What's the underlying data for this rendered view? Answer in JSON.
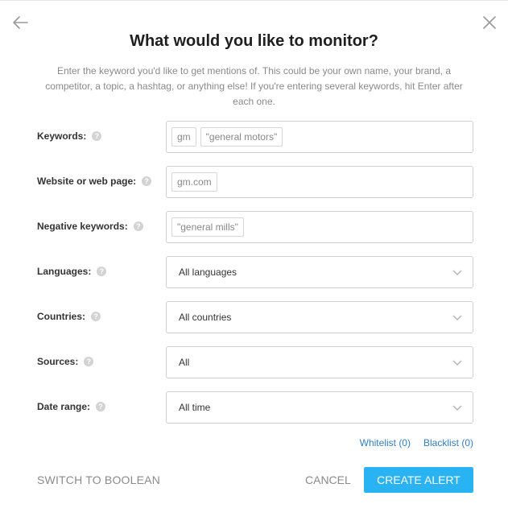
{
  "dialog": {
    "title": "What would you like to monitor?",
    "description": "Enter the keyword you'd like to get mentions of. This could be your own name, your brand, a competitor, a topic, a hashtag, or anything else! If you're entering several keywords, hit Enter after each one."
  },
  "fields": {
    "keywords": {
      "label": "Keywords:",
      "tags": [
        "gm",
        "\"general motors\""
      ]
    },
    "website": {
      "label": "Website or web page:",
      "tags": [
        "gm.com"
      ]
    },
    "negative": {
      "label": "Negative keywords:",
      "tags": [
        "\"general mills\""
      ]
    },
    "languages": {
      "label": "Languages:",
      "value": "All languages"
    },
    "countries": {
      "label": "Countries:",
      "value": "All countries"
    },
    "sources": {
      "label": "Sources:",
      "value": "All"
    },
    "date_range": {
      "label": "Date range:",
      "value": "All time"
    }
  },
  "help_glyph": "?",
  "links": {
    "whitelist": "Whitelist (0)",
    "blacklist": "Blacklist (0)"
  },
  "actions": {
    "switch": "SWITCH TO BOOLEAN",
    "cancel": "CANCEL",
    "create": "CREATE ALERT"
  },
  "colors": {
    "accent": "#2ab3f3",
    "link": "#2f7fc1"
  },
  "icons": {
    "back": "arrow-left-icon",
    "close": "close-icon",
    "help": "question-circle-icon",
    "dropdown": "chevron-down-icon"
  }
}
